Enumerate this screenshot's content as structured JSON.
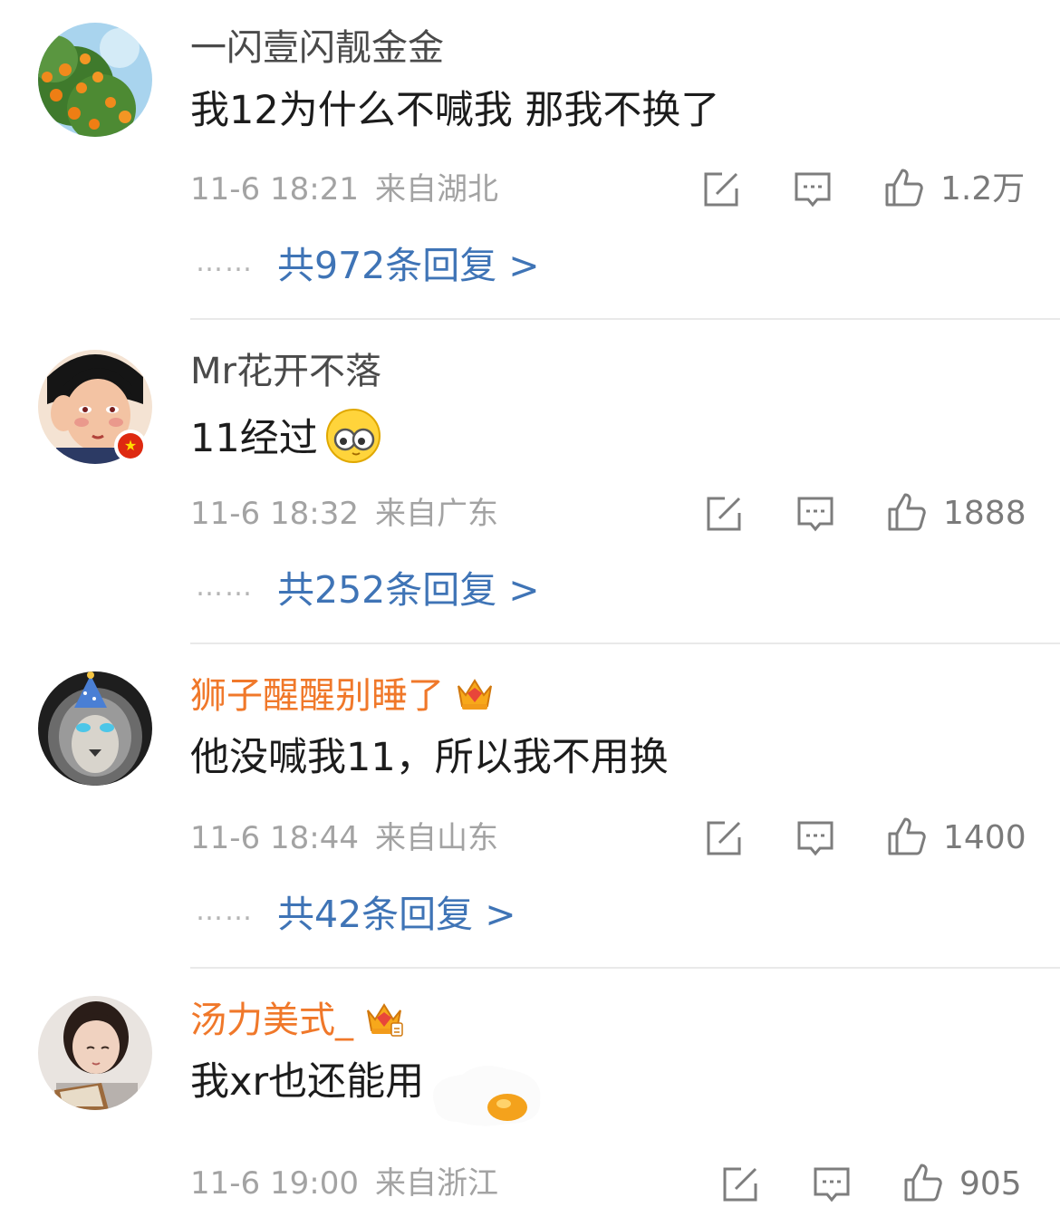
{
  "comments": [
    {
      "username": "一闪壹闪靓金金",
      "vip": false,
      "text": "我12为什么不喊我 那我不换了",
      "time": "11-6 18:21",
      "location": "来自湖北",
      "likes": "1.2万",
      "replies": "共972条回复 >",
      "avatar_icon": "orange-tree-avatar"
    },
    {
      "username": "Mr花开不落",
      "vip": false,
      "text": "11经过",
      "emoji_icon": "peeking-eyes-emoji",
      "time": "11-6 18:32",
      "location": "来自广东",
      "likes": "1888",
      "replies": "共252条回复 >",
      "avatar_icon": "illustrated-boy-avatar"
    },
    {
      "username": "狮子醒醒别睡了",
      "vip": true,
      "text": "他没喊我11，所以我不用换",
      "time": "11-6 18:44",
      "location": "来自山东",
      "likes": "1400",
      "replies": "共42条回复 >",
      "avatar_icon": "lion-avatar"
    },
    {
      "username": "汤力美式_",
      "vip": true,
      "text": "我xr也还能用",
      "time": "11-6 19:00",
      "location": "来自浙江",
      "likes": "905",
      "avatar_icon": "girl-reading-avatar"
    }
  ],
  "dots": "……",
  "colors": {
    "reply_link": "#3f74b6",
    "vip_name": "#f0782a",
    "meta_text": "#a3a3a3",
    "name_text": "#4a4a4a"
  }
}
